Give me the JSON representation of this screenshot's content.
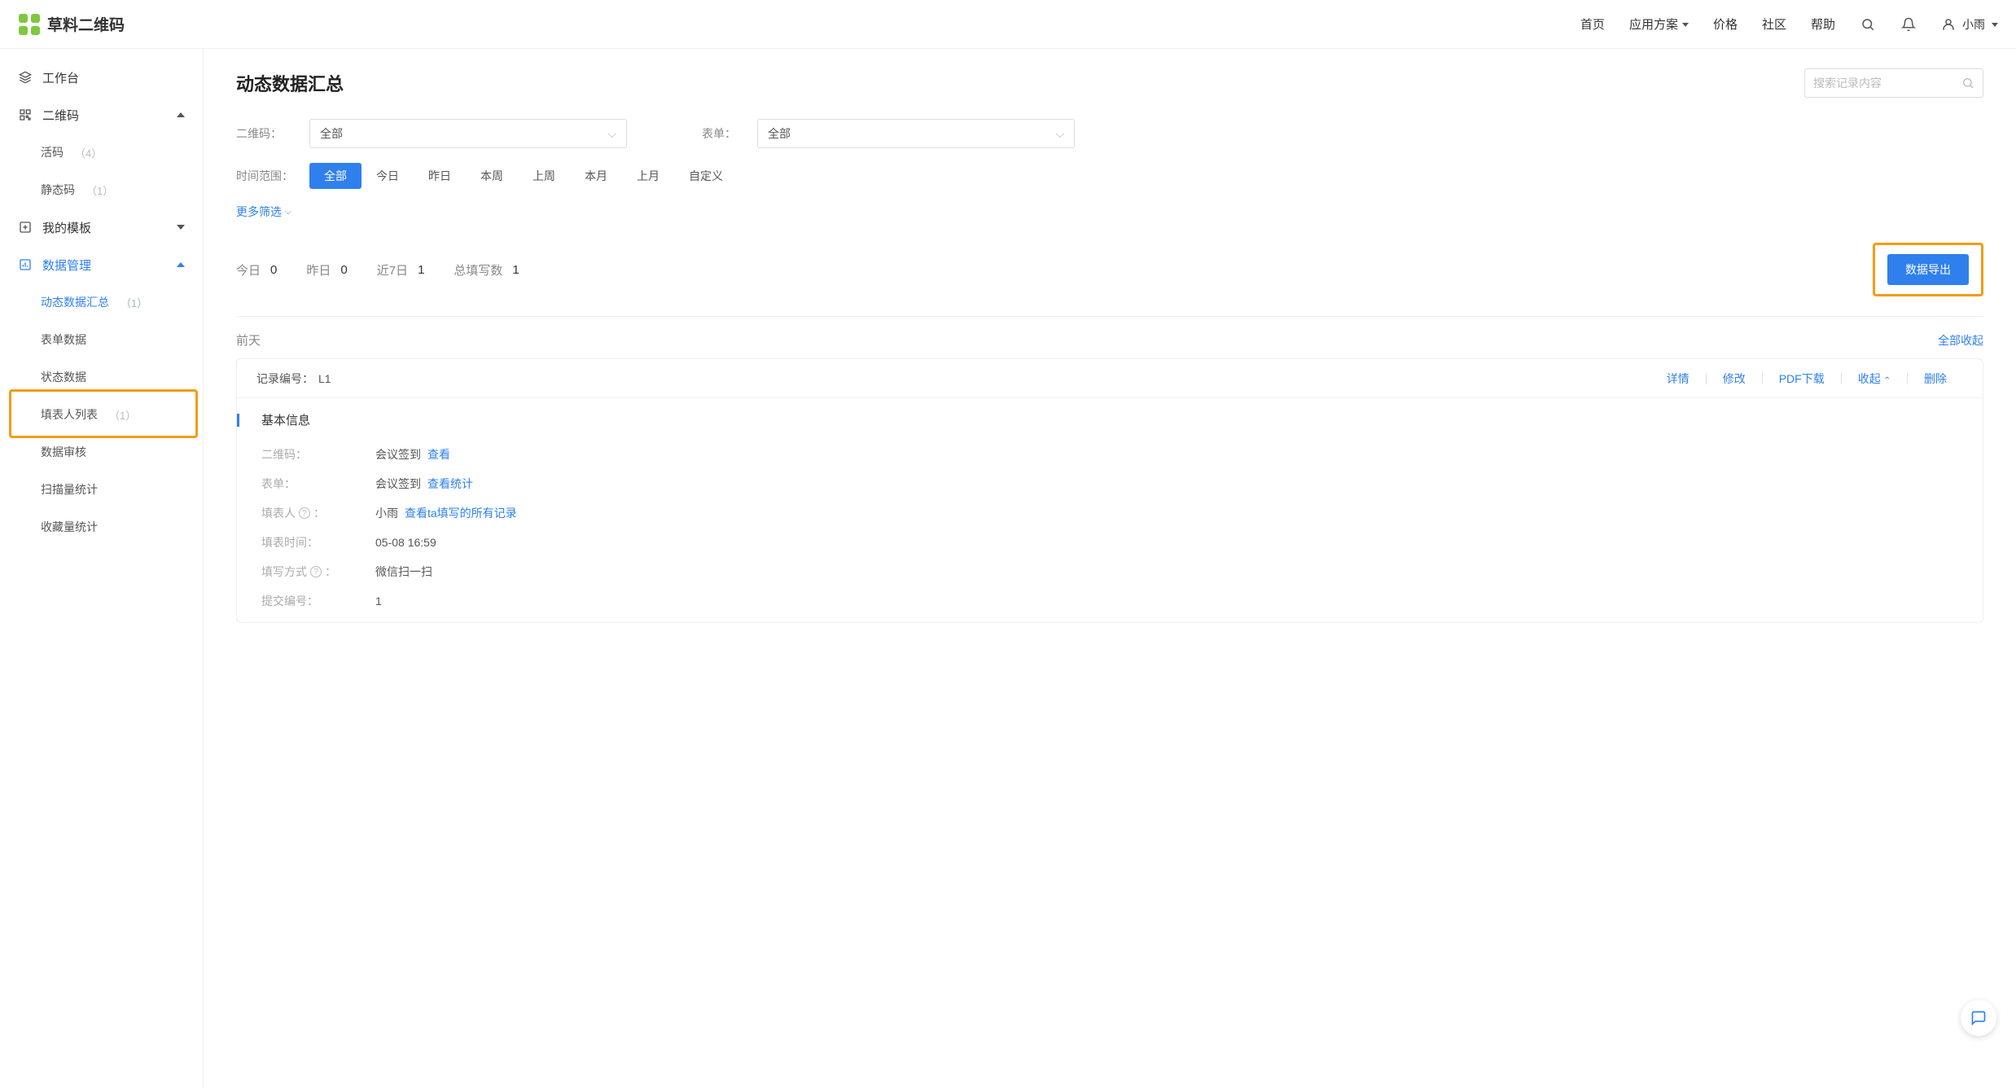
{
  "brand": {
    "name": "草料二维码"
  },
  "nav": {
    "home": "首页",
    "solutions": "应用方案",
    "price": "价格",
    "community": "社区",
    "help": "帮助",
    "user": "小雨"
  },
  "sidebar": {
    "workbench": "工作台",
    "qrcode": {
      "label": "二维码",
      "live": "活码",
      "live_count": "（4）",
      "static": "静态码",
      "static_count": "（1）"
    },
    "templates": "我的模板",
    "data": {
      "label": "数据管理",
      "dynamic": "动态数据汇总",
      "dynamic_count": "（1）",
      "form": "表单数据",
      "status": "状态数据",
      "filler_list": "填表人列表",
      "filler_count": "（1）",
      "review": "数据审核",
      "scan_stats": "扫描量统计",
      "fav_stats": "收藏量统计"
    }
  },
  "page": {
    "title": "动态数据汇总",
    "search_placeholder": "搜索记录内容"
  },
  "filters": {
    "qrcode_label": "二维码：",
    "qrcode_value": "全部",
    "form_label": "表单：",
    "form_value": "全部",
    "time_label": "时间范围：",
    "time": {
      "all": "全部",
      "today": "今日",
      "yesterday": "昨日",
      "this_week": "本周",
      "last_week": "上周",
      "this_month": "本月",
      "last_month": "上月",
      "custom": "自定义"
    },
    "more": "更多筛选"
  },
  "stats": {
    "today_label": "今日",
    "today_val": "0",
    "yesterday_label": "昨日",
    "yesterday_val": "0",
    "last7_label": "近7日",
    "last7_val": "1",
    "total_label": "总填写数",
    "total_val": "1"
  },
  "export_btn": "数据导出",
  "section": {
    "group_label": "前天",
    "collapse_all": "全部收起"
  },
  "record": {
    "id_label": "记录编号：",
    "id_value": "L1",
    "actions": {
      "detail": "详情",
      "edit": "修改",
      "pdf": "PDF下载",
      "collapse": "收起",
      "delete": "删除"
    },
    "info_title": "基本信息",
    "rows": {
      "qrcode_label": "二维码：",
      "qrcode_val": "会议签到",
      "qrcode_link": "查看",
      "form_label": "表单：",
      "form_val": "会议签到",
      "form_link": "查看统计",
      "filler_label": "填表人",
      "filler_val": "小雨",
      "filler_link": "查看ta填写的所有记录",
      "time_label": "填表时间：",
      "time_val": "05-08 16:59",
      "method_label": "填写方式",
      "method_val": "微信扫一扫",
      "submit_id_label": "提交编号：",
      "submit_id_val": "1"
    }
  }
}
